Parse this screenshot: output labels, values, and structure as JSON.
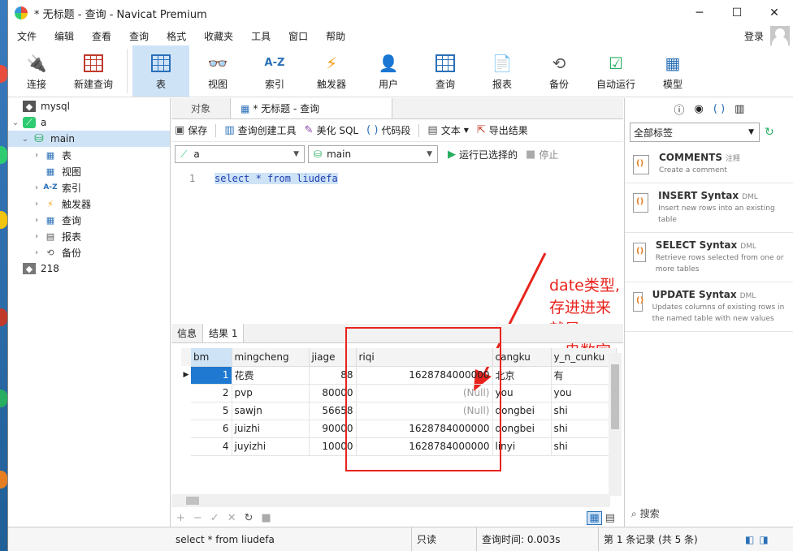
{
  "window": {
    "title": "* 无标题 - 查询 - Navicat Premium",
    "minimize": "─",
    "maximize": "☐",
    "close": "✕"
  },
  "menu": [
    "文件",
    "编辑",
    "查看",
    "查询",
    "格式",
    "收藏夹",
    "工具",
    "窗口",
    "帮助"
  ],
  "login": "登录",
  "toolbar": [
    {
      "label": "连接",
      "icon": "plug-icon"
    },
    {
      "label": "新建查询",
      "icon": "new-query-icon"
    },
    {
      "label": "表",
      "icon": "table-icon",
      "active": true
    },
    {
      "label": "视图",
      "icon": "view-icon"
    },
    {
      "label": "索引",
      "icon": "index-icon",
      "glyph": "A-Z"
    },
    {
      "label": "触发器",
      "icon": "trigger-icon",
      "glyph": "⚡"
    },
    {
      "label": "用户",
      "icon": "user-icon"
    },
    {
      "label": "查询",
      "icon": "query-icon"
    },
    {
      "label": "报表",
      "icon": "report-icon"
    },
    {
      "label": "备份",
      "icon": "backup-icon"
    },
    {
      "label": "自动运行",
      "icon": "autorun-icon"
    },
    {
      "label": "模型",
      "icon": "model-icon"
    }
  ],
  "tree": [
    {
      "label": "mysql"
    },
    {
      "label": "a"
    },
    {
      "label": "main"
    },
    {
      "label": "表"
    },
    {
      "label": "视图"
    },
    {
      "label": "索引"
    },
    {
      "label": "触发器"
    },
    {
      "label": "查询"
    },
    {
      "label": "报表"
    },
    {
      "label": "备份"
    },
    {
      "label": "218"
    }
  ],
  "tabs": {
    "objects": "对象",
    "query": "* 无标题 - 查询"
  },
  "query_toolbar": {
    "save": "保存",
    "builder": "查询创建工具",
    "beautify": "美化 SQL",
    "snippet": "代码段",
    "text": "文本",
    "export": "导出结果"
  },
  "selectors": {
    "connection": "a",
    "database": "main",
    "run": "运行已选择的",
    "stop": "停止"
  },
  "editor": {
    "line": "1",
    "sql": "select * from liudefa"
  },
  "annotation": [
    "date类型,",
    "存进进来就是",
    "一串数字"
  ],
  "result_tabs": {
    "info": "信息",
    "result": "结果 1"
  },
  "grid": {
    "columns": [
      "bm",
      "mingcheng",
      "jiage",
      "riqi",
      "cangku",
      "y_n_cunku"
    ],
    "rows": [
      [
        "1",
        "花费",
        "88",
        "1628784000000",
        "北京",
        "有"
      ],
      [
        "2",
        "pvp",
        "80000",
        "(Null)",
        "you",
        "you"
      ],
      [
        "5",
        "sawjn",
        "56658",
        "(Null)",
        "dongbei",
        "shi"
      ],
      [
        "6",
        "juizhi",
        "90000",
        "1628784000000",
        "dongbei",
        "shi"
      ],
      [
        "4",
        "juyizhi",
        "10000",
        "1628784000000",
        "linyi",
        "shi"
      ]
    ]
  },
  "right_panel": {
    "tag_filter": "全部标签",
    "snippets": [
      {
        "title": "COMMENTS",
        "sub": "注释",
        "desc": "Create a comment"
      },
      {
        "title": "INSERT Syntax",
        "sub": "DML",
        "desc": "Insert new rows into an existing table"
      },
      {
        "title": "SELECT Syntax",
        "sub": "DML",
        "desc": "Retrieve rows selected from one or more tables"
      },
      {
        "title": "UPDATE Syntax",
        "sub": "DML",
        "desc": "Updates columns of existing rows in the named table with new values"
      }
    ],
    "search": "搜索"
  },
  "status": {
    "sql": "select * from liudefa",
    "mode": "只读",
    "time": "查询时间: 0.003s",
    "record": "第 1 条记录 (共 5 条)"
  },
  "colors": {
    "accent": "#1f79d0",
    "selection": "#cfe3f7",
    "annotation": "#e8231d"
  }
}
